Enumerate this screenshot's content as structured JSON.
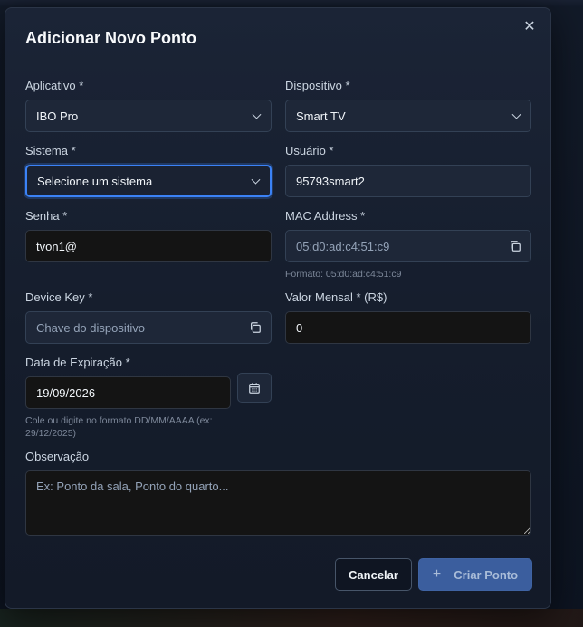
{
  "dialog": {
    "title": "Adicionar Novo Ponto",
    "close_icon": "close-icon"
  },
  "fields": {
    "aplicativo": {
      "label": "Aplicativo *",
      "value": "IBO Pro"
    },
    "dispositivo": {
      "label": "Dispositivo *",
      "value": "Smart TV"
    },
    "sistema": {
      "label": "Sistema *",
      "value": "Selecione um sistema"
    },
    "usuario": {
      "label": "Usuário *",
      "value": "95793smart2"
    },
    "senha": {
      "label": "Senha *",
      "value": "tvon1@"
    },
    "mac": {
      "label": "MAC Address *",
      "value": "05:d0:ad:c4:51:c9",
      "hint": "Formato: 05:d0:ad:c4:51:c9"
    },
    "device_key": {
      "label": "Device Key *",
      "placeholder": "Chave do dispositivo"
    },
    "valor_mensal": {
      "label": "Valor Mensal * (R$)",
      "value": "0"
    },
    "data_expiracao": {
      "label": "Data de Expiração *",
      "value": "19/09/2026",
      "hint": "Cole ou digite no formato DD/MM/AAAA (ex: 29/12/2025)"
    },
    "observacao": {
      "label": "Observação",
      "placeholder": "Ex: Ponto da sala, Ponto do quarto..."
    }
  },
  "actions": {
    "cancel_label": "Cancelar",
    "create_label": "Criar Ponto"
  },
  "colors": {
    "accent": "#3b82f6",
    "primary_button": "#3b5e9e"
  }
}
